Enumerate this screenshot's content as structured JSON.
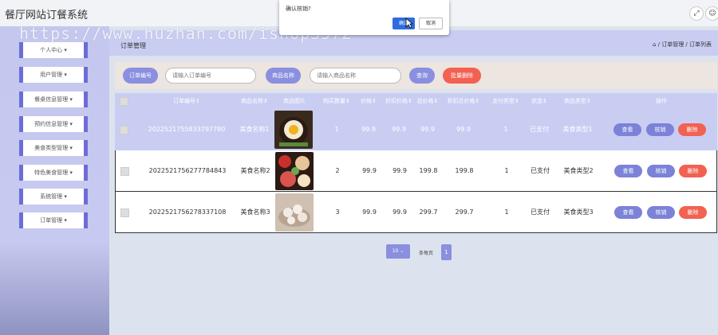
{
  "app": {
    "title": "餐厅网站订餐系统"
  },
  "watermark": "https://www.huzhan.com/ishop3572",
  "topbar": {
    "fullscreen_icon": "fullscreen-icon",
    "user_icon": "user-icon"
  },
  "sidebar": {
    "items": [
      {
        "label": "个人中心 ▾"
      },
      {
        "label": "用户管理 ▾"
      },
      {
        "label": "餐桌信息管理 ▾"
      },
      {
        "label": "预约信息管理 ▾"
      },
      {
        "label": "美食类型管理 ▾"
      },
      {
        "label": "特色美食管理 ▾"
      },
      {
        "label": "系统管理 ▾"
      },
      {
        "label": "订单管理 ▾"
      }
    ]
  },
  "header": {
    "title": "订单管理",
    "breadcrumb": "⌂ / 订单管理 / 订单列表"
  },
  "search": {
    "order_no_label": "订单编号",
    "order_no_placeholder": "请输入订单编号",
    "product_label": "商品名称",
    "product_placeholder": "请输入商品名称",
    "query_label": "查询",
    "batch_delete_label": "批量删除"
  },
  "table": {
    "columns": [
      "订单编号⇕",
      "商品名称⇕",
      "商品图片",
      "购买数量⇕",
      "价格⇕",
      "折扣价格⇕",
      "总价格⇕",
      "折扣总价格⇕",
      "支付类型⇕",
      "状态⇕",
      "商品类型⇕",
      "操作"
    ],
    "rows": [
      {
        "order_no": "2022521755833797780",
        "name": "美食名称1",
        "qty": "1",
        "price": "99.9",
        "discount": "99.9",
        "total": "99.9",
        "discount_total": "99.9",
        "pay_type": "1",
        "status": "已支付",
        "type": "美食类型1"
      },
      {
        "order_no": "2022521756277784843",
        "name": "美食名称2",
        "qty": "2",
        "price": "99.9",
        "discount": "99.9",
        "total": "199.8",
        "discount_total": "199.8",
        "pay_type": "1",
        "status": "已支付",
        "type": "美食类型2"
      },
      {
        "order_no": "2022521756278337108",
        "name": "美食名称3",
        "qty": "3",
        "price": "99.9",
        "discount": "99.9",
        "total": "299.7",
        "discount_total": "299.7",
        "pay_type": "1",
        "status": "已支付",
        "type": "美食类型3"
      }
    ],
    "actions": {
      "view": "查看",
      "verify": "核销",
      "delete": "删除"
    }
  },
  "pagination": {
    "page_size": "10",
    "per_page_label": "条每页",
    "current_page": "1"
  },
  "dialog": {
    "message": "确认核销?",
    "ok_label": "确定",
    "cancel_label": "取消"
  },
  "colors": {
    "accent": "#8a8fe0",
    "danger": "#f26151",
    "header_bg": "#c9cdf2",
    "sidebar_bg": "#c4c8ee"
  }
}
